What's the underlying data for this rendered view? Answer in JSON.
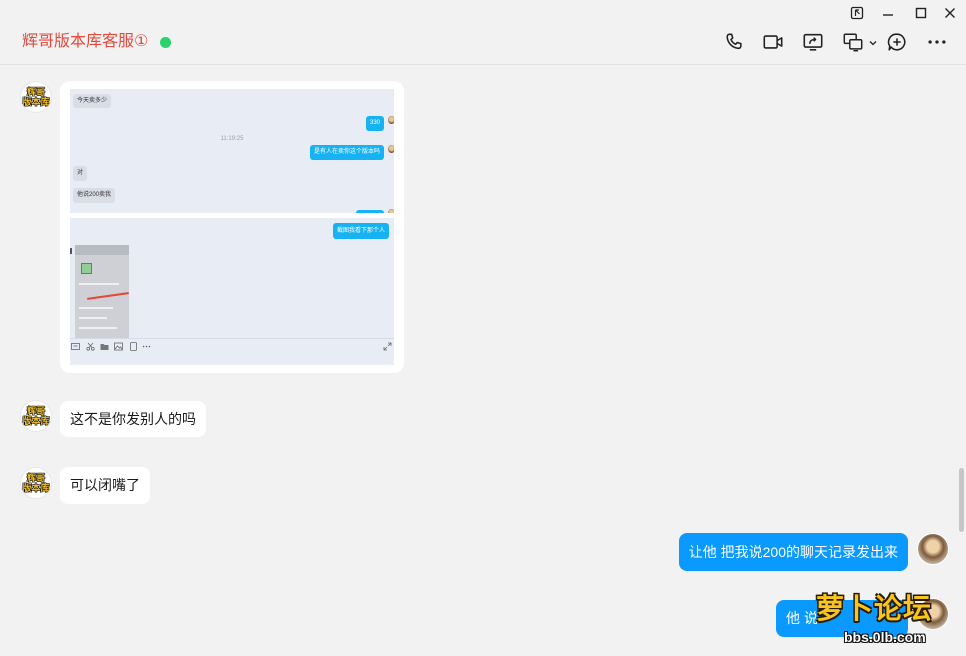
{
  "theme": {
    "title_color": "#e34b3f",
    "online_color": "#2bd16c",
    "bubble_blue": "#0a99ff",
    "embedded_bubble_blue": "#17b2f2",
    "background": "#f2f2f2"
  },
  "window_controls": [
    "pin-icon",
    "minimize-icon",
    "maximize-icon",
    "close-icon"
  ],
  "header": {
    "title": "辉哥版本库客服①",
    "toolbar_icons": [
      "phone-icon",
      "video-call-icon",
      "screen-share-icon",
      "remote-desktop-icon",
      "chevron-down-icon",
      "add-circle-icon",
      "more-icon"
    ]
  },
  "contact_avatar": {
    "line1": "辉哥",
    "line2": "版本库"
  },
  "messages": [
    {
      "side": "left",
      "type": "image",
      "image": {
        "top_panel": [
          {
            "side": "left",
            "text": "今天卖多少"
          },
          {
            "time": "11:19:25"
          },
          {
            "side": "right",
            "text": "330"
          },
          {
            "side": "right",
            "text": "是有人在卖你这个版本吗"
          },
          {
            "side": "left",
            "text": "对"
          },
          {
            "side": "left",
            "text": "他说200卖我"
          }
        ],
        "bottom_panel": [
          {
            "side": "right",
            "text": "截图我看下那个人"
          }
        ],
        "toolbar_icons": [
          "emoji-icon",
          "scissors-icon",
          "folder-icon",
          "image-icon",
          "window-icon",
          "more-icon",
          "expand-icon"
        ]
      }
    },
    {
      "side": "left",
      "type": "text",
      "text": "这不是你发别人的吗"
    },
    {
      "side": "left",
      "type": "text",
      "text": "可以闭嘴了"
    },
    {
      "side": "right",
      "type": "text",
      "text": "让他 把我说200的聊天记录发出来"
    },
    {
      "side": "right",
      "type": "text",
      "text": "他 说"
    }
  ],
  "watermark": {
    "title": "萝卜论坛",
    "url": "bbs.0lb.com"
  }
}
